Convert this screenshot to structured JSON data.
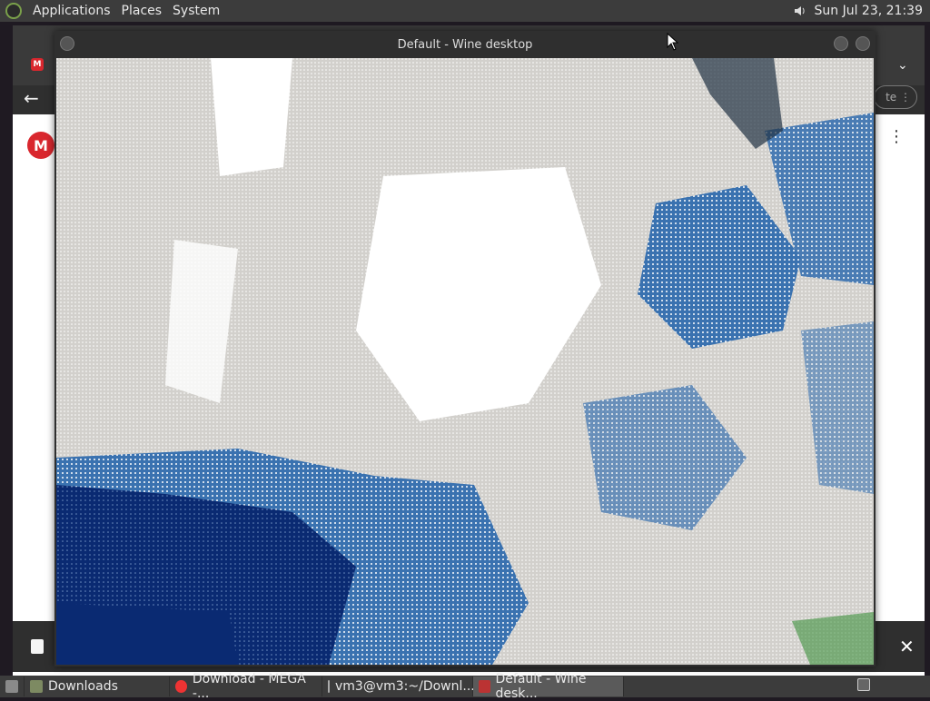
{
  "top_panel": {
    "menus": [
      "Applications",
      "Places",
      "System"
    ],
    "clock": "Sun Jul 23, 21:39"
  },
  "wine_window": {
    "title": "Default - Wine desktop"
  },
  "browser": {
    "mega_initial": "M",
    "update_label": "te"
  },
  "taskbar": {
    "items": [
      {
        "label": "Downloads"
      },
      {
        "label": "Download - MEGA -..."
      },
      {
        "label": "vm3@vm3:~/Downl..."
      },
      {
        "label": "Default - Wine desk..."
      }
    ]
  },
  "icons": {
    "back": "arrow-left-icon",
    "kebab": "more-vertical-icon",
    "close": "close-icon",
    "volume": "volume-icon",
    "chevron": "chevron-down-icon"
  },
  "colors": {
    "panel_bg": "#3c3c3c",
    "mega_red": "#d9272e",
    "sea_dark": "#0a2a72",
    "sea_mid": "#3a72b0",
    "land": "#d2d0cc"
  }
}
